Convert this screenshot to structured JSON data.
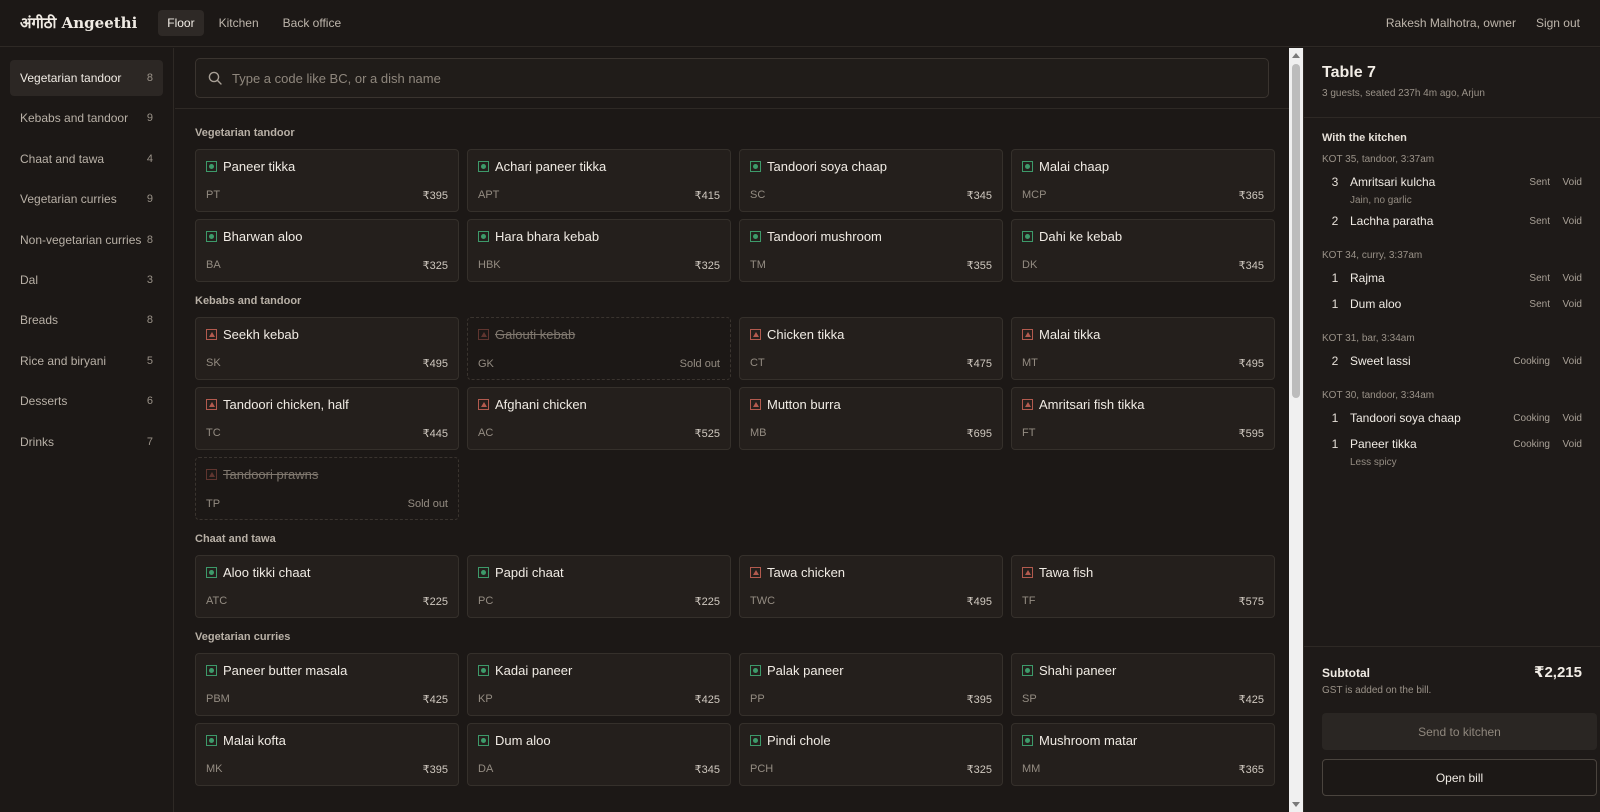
{
  "app": {
    "brand": "अंगीठी Angeethi",
    "nav": [
      {
        "label": "Floor",
        "active": true
      },
      {
        "label": "Kitchen",
        "active": false
      },
      {
        "label": "Back office",
        "active": false
      }
    ],
    "user": "Rakesh Malhotra, owner",
    "sign_out": "Sign out"
  },
  "sidebar": {
    "categories": [
      {
        "label": "Vegetarian tandoor",
        "count": "8",
        "active": true
      },
      {
        "label": "Kebabs and tandoor",
        "count": "9",
        "active": false
      },
      {
        "label": "Chaat and tawa",
        "count": "4",
        "active": false
      },
      {
        "label": "Vegetarian curries",
        "count": "9",
        "active": false
      },
      {
        "label": "Non-vegetarian curries",
        "count": "8",
        "active": false
      },
      {
        "label": "Dal",
        "count": "3",
        "active": false
      },
      {
        "label": "Breads",
        "count": "8",
        "active": false
      },
      {
        "label": "Rice and biryani",
        "count": "5",
        "active": false
      },
      {
        "label": "Desserts",
        "count": "6",
        "active": false
      },
      {
        "label": "Drinks",
        "count": "7",
        "active": false
      }
    ]
  },
  "search": {
    "placeholder": "Type a code like BC, or a dish name",
    "icon": "search-icon"
  },
  "menu": {
    "sections": [
      {
        "title": "Vegetarian tandoor",
        "items": [
          {
            "name": "Paneer tikka",
            "code": "PT",
            "price": "₹395",
            "type": "veg",
            "sold_out": false
          },
          {
            "name": "Achari paneer tikka",
            "code": "APT",
            "price": "₹415",
            "type": "veg",
            "sold_out": false
          },
          {
            "name": "Tandoori soya chaap",
            "code": "SC",
            "price": "₹345",
            "type": "veg",
            "sold_out": false
          },
          {
            "name": "Malai chaap",
            "code": "MCP",
            "price": "₹365",
            "type": "veg",
            "sold_out": false
          },
          {
            "name": "Bharwan aloo",
            "code": "BA",
            "price": "₹325",
            "type": "veg",
            "sold_out": false
          },
          {
            "name": "Hara bhara kebab",
            "code": "HBK",
            "price": "₹325",
            "type": "veg",
            "sold_out": false
          },
          {
            "name": "Tandoori mushroom",
            "code": "TM",
            "price": "₹355",
            "type": "veg",
            "sold_out": false
          },
          {
            "name": "Dahi ke kebab",
            "code": "DK",
            "price": "₹345",
            "type": "veg",
            "sold_out": false
          }
        ]
      },
      {
        "title": "Kebabs and tandoor",
        "items": [
          {
            "name": "Seekh kebab",
            "code": "SK",
            "price": "₹495",
            "type": "nonveg",
            "sold_out": false
          },
          {
            "name": "Galouti kebab",
            "code": "GK",
            "price": "Sold out",
            "type": "nonveg",
            "sold_out": true
          },
          {
            "name": "Chicken tikka",
            "code": "CT",
            "price": "₹475",
            "type": "nonveg",
            "sold_out": false
          },
          {
            "name": "Malai tikka",
            "code": "MT",
            "price": "₹495",
            "type": "nonveg",
            "sold_out": false
          },
          {
            "name": "Tandoori chicken, half",
            "code": "TC",
            "price": "₹445",
            "type": "nonveg",
            "sold_out": false
          },
          {
            "name": "Afghani chicken",
            "code": "AC",
            "price": "₹525",
            "type": "nonveg",
            "sold_out": false
          },
          {
            "name": "Mutton burra",
            "code": "MB",
            "price": "₹695",
            "type": "nonveg",
            "sold_out": false
          },
          {
            "name": "Amritsari fish tikka",
            "code": "FT",
            "price": "₹595",
            "type": "nonveg",
            "sold_out": false
          },
          {
            "name": "Tandoori prawns",
            "code": "TP",
            "price": "Sold out",
            "type": "nonveg",
            "sold_out": true
          }
        ]
      },
      {
        "title": "Chaat and tawa",
        "items": [
          {
            "name": "Aloo tikki chaat",
            "code": "ATC",
            "price": "₹225",
            "type": "veg",
            "sold_out": false
          },
          {
            "name": "Papdi chaat",
            "code": "PC",
            "price": "₹225",
            "type": "veg",
            "sold_out": false
          },
          {
            "name": "Tawa chicken",
            "code": "TWC",
            "price": "₹495",
            "type": "nonveg",
            "sold_out": false
          },
          {
            "name": "Tawa fish",
            "code": "TF",
            "price": "₹575",
            "type": "nonveg",
            "sold_out": false
          }
        ]
      },
      {
        "title": "Vegetarian curries",
        "items": [
          {
            "name": "Paneer butter masala",
            "code": "PBM",
            "price": "₹425",
            "type": "veg",
            "sold_out": false
          },
          {
            "name": "Kadai paneer",
            "code": "KP",
            "price": "₹425",
            "type": "veg",
            "sold_out": false
          },
          {
            "name": "Palak paneer",
            "code": "PP",
            "price": "₹395",
            "type": "veg",
            "sold_out": false
          },
          {
            "name": "Shahi paneer",
            "code": "SP",
            "price": "₹425",
            "type": "veg",
            "sold_out": false
          },
          {
            "name": "Malai kofta",
            "code": "MK",
            "price": "₹395",
            "type": "veg",
            "sold_out": false
          },
          {
            "name": "Dum aloo",
            "code": "DA",
            "price": "₹345",
            "type": "veg",
            "sold_out": false
          },
          {
            "name": "Pindi chole",
            "code": "PCH",
            "price": "₹325",
            "type": "veg",
            "sold_out": false
          },
          {
            "name": "Mushroom matar",
            "code": "MM",
            "price": "₹365",
            "type": "veg",
            "sold_out": false
          }
        ]
      }
    ]
  },
  "order": {
    "table": "Table 7",
    "subtitle": "3 guests, seated 237h 4m ago, Arjun",
    "kitchen_title": "With the kitchen",
    "kots": [
      {
        "header": "KOT 35, tandoor, 3:37am",
        "items": [
          {
            "qty": "3",
            "name": "Amritsari kulcha",
            "note": "Jain, no garlic",
            "status": "Sent",
            "void": "Void"
          },
          {
            "qty": "2",
            "name": "Lachha paratha",
            "note": "",
            "status": "Sent",
            "void": "Void"
          }
        ]
      },
      {
        "header": "KOT 34, curry, 3:37am",
        "items": [
          {
            "qty": "1",
            "name": "Rajma",
            "note": "",
            "status": "Sent",
            "void": "Void"
          },
          {
            "qty": "1",
            "name": "Dum aloo",
            "note": "",
            "status": "Sent",
            "void": "Void"
          }
        ]
      },
      {
        "header": "KOT 31, bar, 3:34am",
        "items": [
          {
            "qty": "2",
            "name": "Sweet lassi",
            "note": "",
            "status": "Cooking",
            "void": "Void"
          }
        ]
      },
      {
        "header": "KOT 30, tandoor, 3:34am",
        "items": [
          {
            "qty": "1",
            "name": "Tandoori soya chaap",
            "note": "",
            "status": "Cooking",
            "void": "Void"
          },
          {
            "qty": "1",
            "name": "Paneer tikka",
            "note": "Less spicy",
            "status": "Cooking",
            "void": "Void"
          }
        ]
      }
    ],
    "subtotal_label": "Subtotal",
    "subtotal_value": "₹2,215",
    "gst_note": "GST is added on the bill.",
    "send_label": "Send to kitchen",
    "open_label": "Open bill"
  },
  "colors": {
    "background": "#1c1816",
    "veg_mark": "#3d9a6a",
    "nonveg_mark": "#b25a4e"
  }
}
